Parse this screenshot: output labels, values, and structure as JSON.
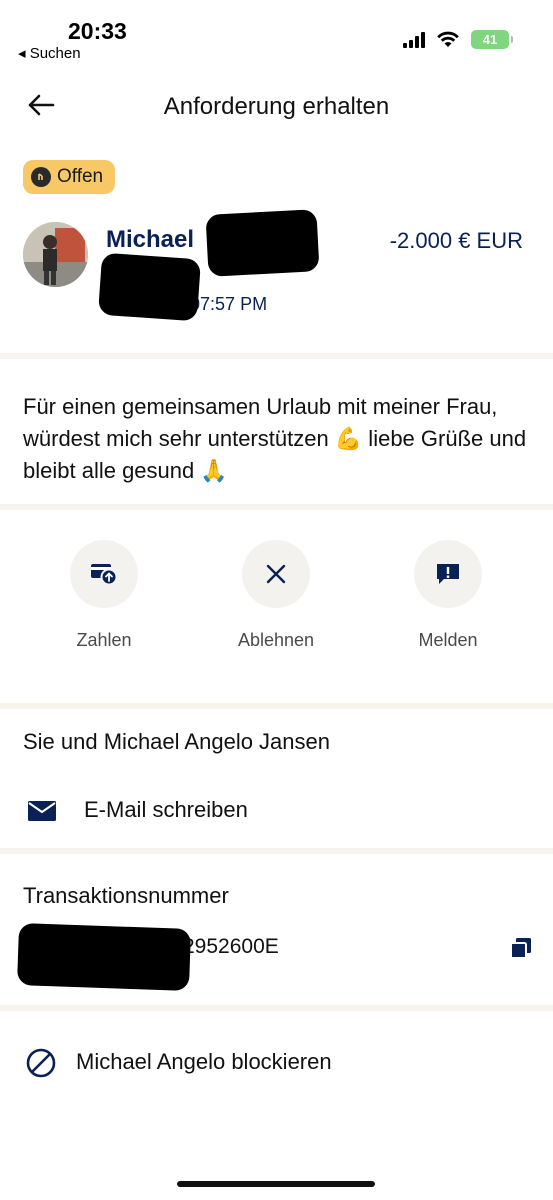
{
  "status_bar": {
    "time": "20:33",
    "back_app": "◂ Suchen",
    "battery": "41"
  },
  "header": {
    "title": "Anforderung erhalten"
  },
  "badge": {
    "label": "Offen"
  },
  "request": {
    "sender_name": "Michael",
    "amount": "-2.000 € EUR",
    "date_visible": "16, 07:57 PM"
  },
  "message": {
    "text": "Für einen gemeinsamen Urlaub mit meiner Frau, würdest mich sehr unterstützen 💪 liebe Grüße und bleibt alle gesund 🙏"
  },
  "actions": [
    {
      "label": "Zahlen",
      "icon": "pay-icon"
    },
    {
      "label": "Ablehnen",
      "icon": "close-icon"
    },
    {
      "label": "Melden",
      "icon": "report-icon"
    }
  ],
  "contact": {
    "title": "Sie und Michael Angelo Jansen",
    "email_label": "E-Mail schreiben"
  },
  "transaction": {
    "title": "Transaktionsnummer",
    "number_visible": "2952600E"
  },
  "block": {
    "label": "Michael Angelo blockieren"
  },
  "colors": {
    "navy": "#0a2156",
    "badge": "#f7c865",
    "separator": "#f7f4ee"
  }
}
